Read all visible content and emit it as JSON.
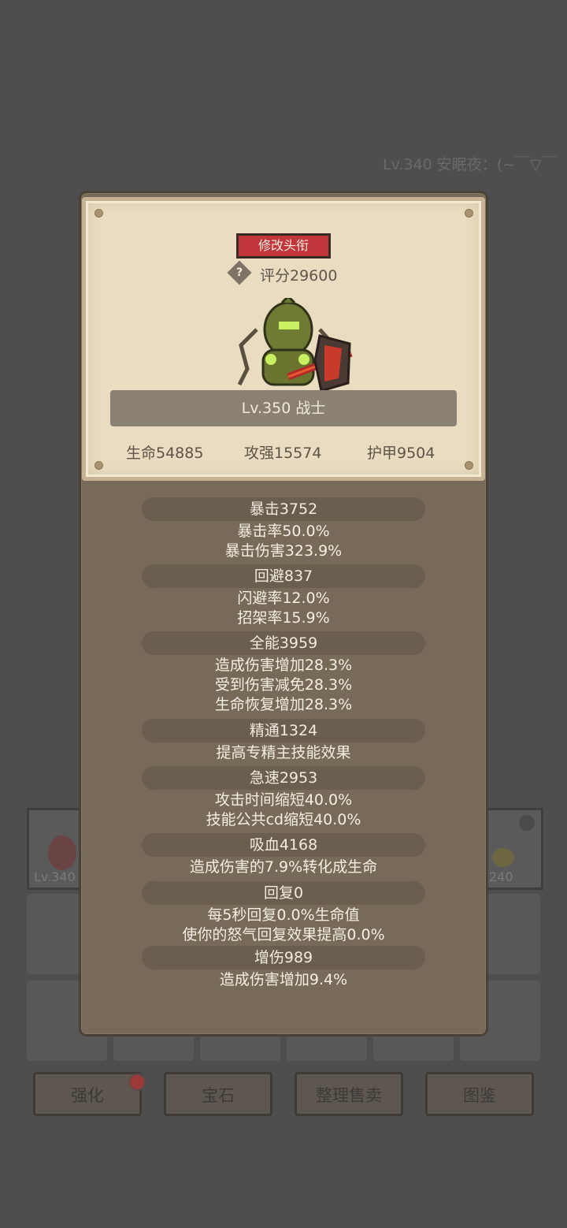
{
  "background": {
    "header_text": "Lv.340 安眠夜：(~￣▽￣",
    "equip_left_level": "Lv.340",
    "equip_right_level": "240",
    "buttons": [
      "强化",
      "宝石",
      "整理售卖",
      "图鉴"
    ]
  },
  "panel": {
    "title_button": "修改头衔",
    "help_icon": "?",
    "score": "评分29600",
    "hero_icon": "armored-warrior-with-axe",
    "name": "Lv.350 战士",
    "base_stats": [
      "生命54885",
      "攻强15574",
      "护甲9504"
    ],
    "groups": [
      {
        "head": "暴击3752",
        "lines": [
          "暴击率50.0%",
          "暴击伤害323.9%"
        ]
      },
      {
        "head": "回避837",
        "lines": [
          "闪避率12.0%",
          "招架率15.9%"
        ]
      },
      {
        "head": "全能3959",
        "lines": [
          "造成伤害增加28.3%",
          "受到伤害减免28.3%",
          "生命恢复增加28.3%"
        ]
      },
      {
        "head": "精通1324",
        "lines": [
          "提高专精主技能效果"
        ]
      },
      {
        "head": "急速2953",
        "lines": [
          "攻击时间缩短40.0%",
          "技能公共cd缩短40.0%"
        ]
      },
      {
        "head": "吸血4168",
        "lines": [
          "造成伤害的7.9%转化成生命"
        ]
      },
      {
        "head": "回复0",
        "lines": [
          "每5秒回复0.0%生命值",
          "使你的怒气回复效果提高0.0%"
        ]
      },
      {
        "head": "增伤989",
        "lines": [
          "造成伤害增加9.4%"
        ]
      }
    ]
  },
  "colors": {
    "title_button": "#c0363a",
    "panel": "#776a58",
    "card": "#e9dcc0"
  }
}
